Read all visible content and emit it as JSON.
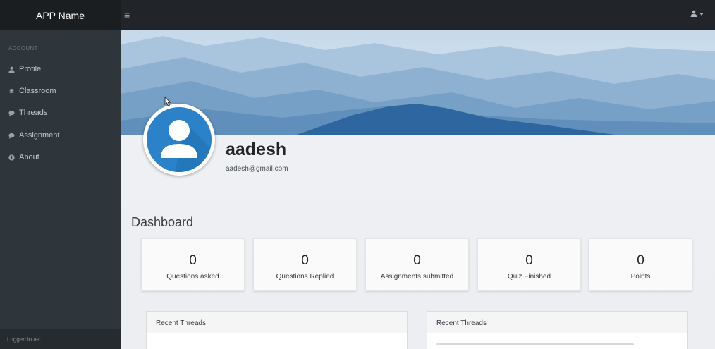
{
  "app": {
    "name": "APP Name"
  },
  "header": {
    "menu_icon": "hamburger-icon",
    "user_icon": "user-icon"
  },
  "sidebar": {
    "section_title": "ACCOUNT",
    "items": [
      {
        "label": "Profile",
        "icon": "user-icon"
      },
      {
        "label": "Classroom",
        "icon": "classroom-icon"
      },
      {
        "label": "Threads",
        "icon": "comment-icon"
      },
      {
        "label": "Assignment",
        "icon": "comment-icon"
      },
      {
        "label": "About",
        "icon": "info-icon"
      }
    ],
    "footer": "Logged in as:"
  },
  "profile": {
    "username": "aadesh",
    "email": "aadesh@gmail.com"
  },
  "dashboard": {
    "title": "Dashboard",
    "stats": [
      {
        "value": "0",
        "label": "Questions asked"
      },
      {
        "value": "0",
        "label": "Questions Replied"
      },
      {
        "value": "0",
        "label": "Assignments submitted"
      },
      {
        "value": "0",
        "label": "Quiz Finished"
      },
      {
        "value": "0",
        "label": "Points"
      }
    ]
  },
  "panels": [
    {
      "title": "Recent Threads"
    },
    {
      "title": "Recent Threads"
    }
  ],
  "colors": {
    "topbar": "#212529",
    "sidebar": "#2e353b",
    "avatar": "#2b82c9"
  }
}
